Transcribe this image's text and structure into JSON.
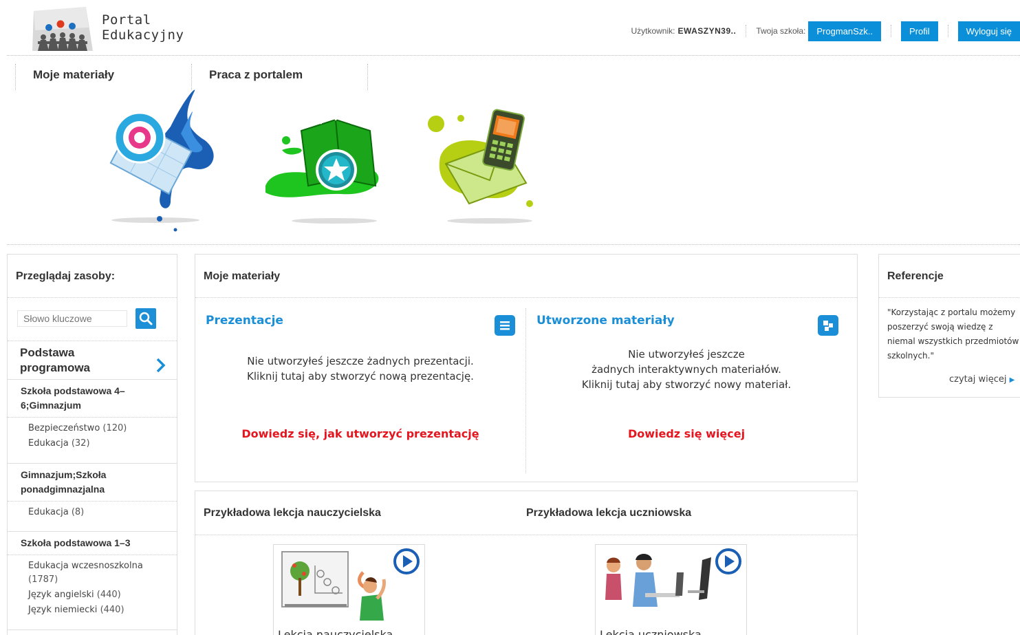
{
  "colors": {
    "accent_blue": "#0a8fd8",
    "link_red": "#e4151f",
    "section_blue": "#1a8ed6"
  },
  "header": {
    "logo_line1": "Portal",
    "logo_line2": "Edukacyjny",
    "user_label": "Użytkownik:",
    "user_name": "EWASZYN39..",
    "school_label": "Twoja szkoła:",
    "school_button": "ProgmanSzk..",
    "profile_button": "Profil",
    "logout_button": "Wyloguj się"
  },
  "topnav": {
    "items": [
      {
        "label": "Moje materiały",
        "icon": "presentation-target-icon"
      },
      {
        "label": "Praca z portalem",
        "icon": "book-star-icon"
      },
      {
        "label": "",
        "icon": "phone-envelope-icon"
      }
    ]
  },
  "sidebar": {
    "title": "Przeglądaj zasoby:",
    "search_placeholder": "Słowo kluczowe",
    "search_icon": "search-icon",
    "core_curriculum": "Podstawa programowa",
    "categories": [
      {
        "title": "Szkoła podstawowa 4–6;Gimnazjum",
        "items": [
          {
            "label": "Bezpieczeństwo",
            "count": "(120)"
          },
          {
            "label": "Edukacja",
            "count": "(32)"
          }
        ]
      },
      {
        "title": "Gimnazjum;Szkoła ponadgimnazjalna",
        "items": [
          {
            "label": "Edukacja",
            "count": "(8)"
          }
        ]
      },
      {
        "title": "Szkoła podstawowa 1–3",
        "items": [
          {
            "label": "Edukacja wczesnoszkolna",
            "count": "(1787)"
          },
          {
            "label": "Język angielski",
            "count": "(440)"
          },
          {
            "label": "Język niemiecki",
            "count": "(440)"
          }
        ]
      }
    ]
  },
  "materials": {
    "title": "Moje materiały",
    "presentations": {
      "title": "Prezentacje",
      "icon": "list-icon",
      "msg_line1": "Nie utworzyłeś jeszcze żadnych prezentacji.",
      "msg_line2": "Kliknij tutaj aby stworzyć nową prezentację.",
      "link": "Dowiedz się, jak utworzyć prezentację"
    },
    "created": {
      "title": "Utworzone materiały",
      "icon": "blocks-icon",
      "msg_line1": "Nie utworzyłeś jeszcze",
      "msg_line2": "żadnych interaktywnych materiałów.",
      "msg_line3": "Kliknij tutaj aby stworzyć nowy materiał.",
      "link": "Dowiedz się więcej"
    }
  },
  "lessons": {
    "teacher_title": "Przykładowa lekcja nauczycielska",
    "student_title": "Przykładowa lekcja uczniowska",
    "teacher_caption": "Lekcja nauczycielska",
    "student_caption": "Lekcja uczniowska",
    "play_icon": "play-icon"
  },
  "references": {
    "title": "Referencje",
    "quote_line1": "\"Korzystając z portalu możemy",
    "quote_line2": "poszerzyć swoją wiedzę z",
    "quote_line3": "niemal wszystkich przedmiotów",
    "quote_line4": "szkolnych.\"",
    "more": "czytaj więcej"
  }
}
